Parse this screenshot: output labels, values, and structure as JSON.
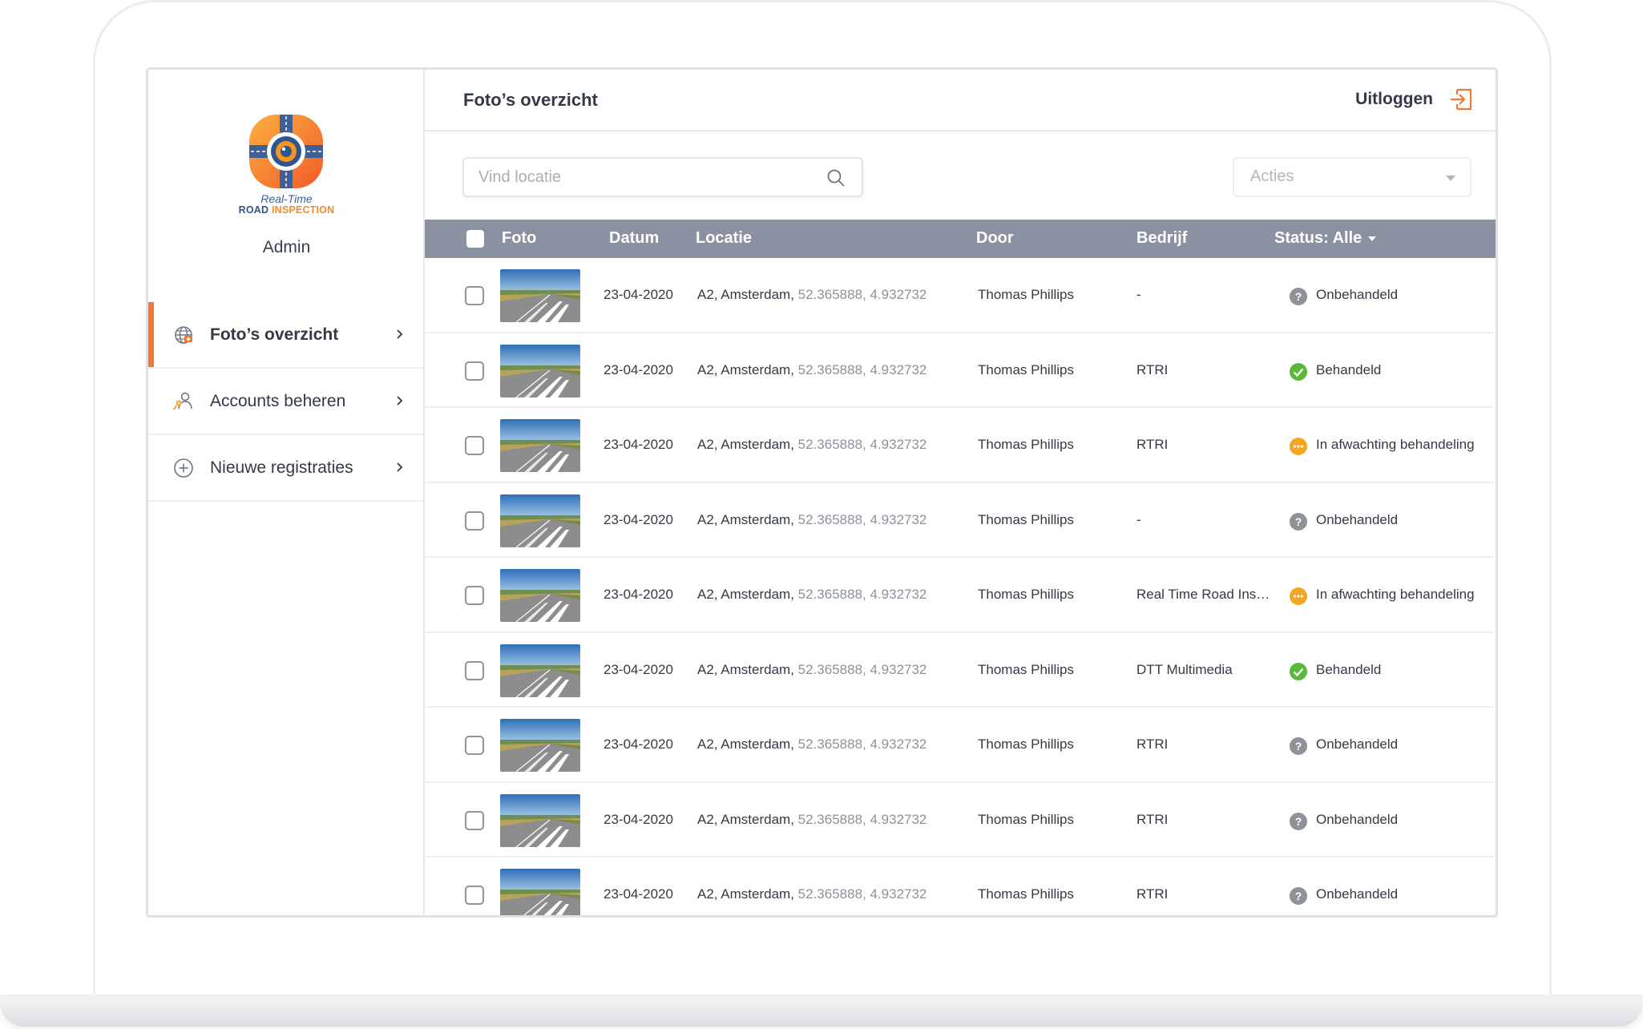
{
  "brand": {
    "line1": "Real-Time",
    "line2a": "ROAD",
    "line2b": "INSPECTION",
    "user_role": "Admin",
    "colors": {
      "orange": "#f27a33",
      "blue": "#2f5591",
      "header_gray": "#8a91a0"
    }
  },
  "sidebar": {
    "items": [
      {
        "label": "Foto’s overzicht",
        "icon": "globe-camera-icon",
        "active": true
      },
      {
        "label": "Accounts beheren",
        "icon": "accounts-key-icon",
        "active": false
      },
      {
        "label": "Nieuwe registraties",
        "icon": "plus-circle-icon",
        "active": false
      }
    ]
  },
  "header": {
    "title": "Foto’s overzicht",
    "logout_label": "Uitloggen"
  },
  "toolbar": {
    "search_placeholder": "Vind locatie",
    "actions_label": "Acties"
  },
  "table": {
    "columns": {
      "foto": "Foto",
      "datum": "Datum",
      "locatie": "Locatie",
      "door": "Door",
      "bedrijf": "Bedrijf",
      "status": "Status: Alle"
    },
    "rows": [
      {
        "datum": "23-04-2020",
        "locatie": "A2, Amsterdam,",
        "coords": "52.365888, 4.932732",
        "door": "Thomas Phillips",
        "bedrijf": "-",
        "status": "Onbehandeld",
        "status_type": "unknown"
      },
      {
        "datum": "23-04-2020",
        "locatie": "A2, Amsterdam,",
        "coords": "52.365888, 4.932732",
        "door": "Thomas Phillips",
        "bedrijf": "RTRI",
        "status": "Behandeld",
        "status_type": "done"
      },
      {
        "datum": "23-04-2020",
        "locatie": "A2, Amsterdam,",
        "coords": "52.365888, 4.932732",
        "door": "Thomas Phillips",
        "bedrijf": "RTRI",
        "status": "In afwachting behandeling",
        "status_type": "pending"
      },
      {
        "datum": "23-04-2020",
        "locatie": "A2, Amsterdam,",
        "coords": "52.365888, 4.932732",
        "door": "Thomas Phillips",
        "bedrijf": "-",
        "status": "Onbehandeld",
        "status_type": "unknown"
      },
      {
        "datum": "23-04-2020",
        "locatie": "A2, Amsterdam,",
        "coords": "52.365888, 4.932732",
        "door": "Thomas Phillips",
        "bedrijf": "Real Time Road Ins…",
        "status": "In afwachting behandeling",
        "status_type": "pending"
      },
      {
        "datum": "23-04-2020",
        "locatie": "A2, Amsterdam,",
        "coords": "52.365888, 4.932732",
        "door": "Thomas Phillips",
        "bedrijf": "DTT Multimedia",
        "status": "Behandeld",
        "status_type": "done"
      },
      {
        "datum": "23-04-2020",
        "locatie": "A2, Amsterdam,",
        "coords": "52.365888, 4.932732",
        "door": "Thomas Phillips",
        "bedrijf": "RTRI",
        "status": "Onbehandeld",
        "status_type": "unknown"
      },
      {
        "datum": "23-04-2020",
        "locatie": "A2, Amsterdam,",
        "coords": "52.365888, 4.932732",
        "door": "Thomas Phillips",
        "bedrijf": "RTRI",
        "status": "Onbehandeld",
        "status_type": "unknown"
      },
      {
        "datum": "23-04-2020",
        "locatie": "A2, Amsterdam,",
        "coords": "52.365888, 4.932732",
        "door": "Thomas Phillips",
        "bedrijf": "RTRI",
        "status": "Onbehandeld",
        "status_type": "unknown"
      }
    ],
    "status_colors": {
      "unknown": "#8e9299",
      "done": "#5bb83a",
      "pending": "#f5a623"
    }
  }
}
